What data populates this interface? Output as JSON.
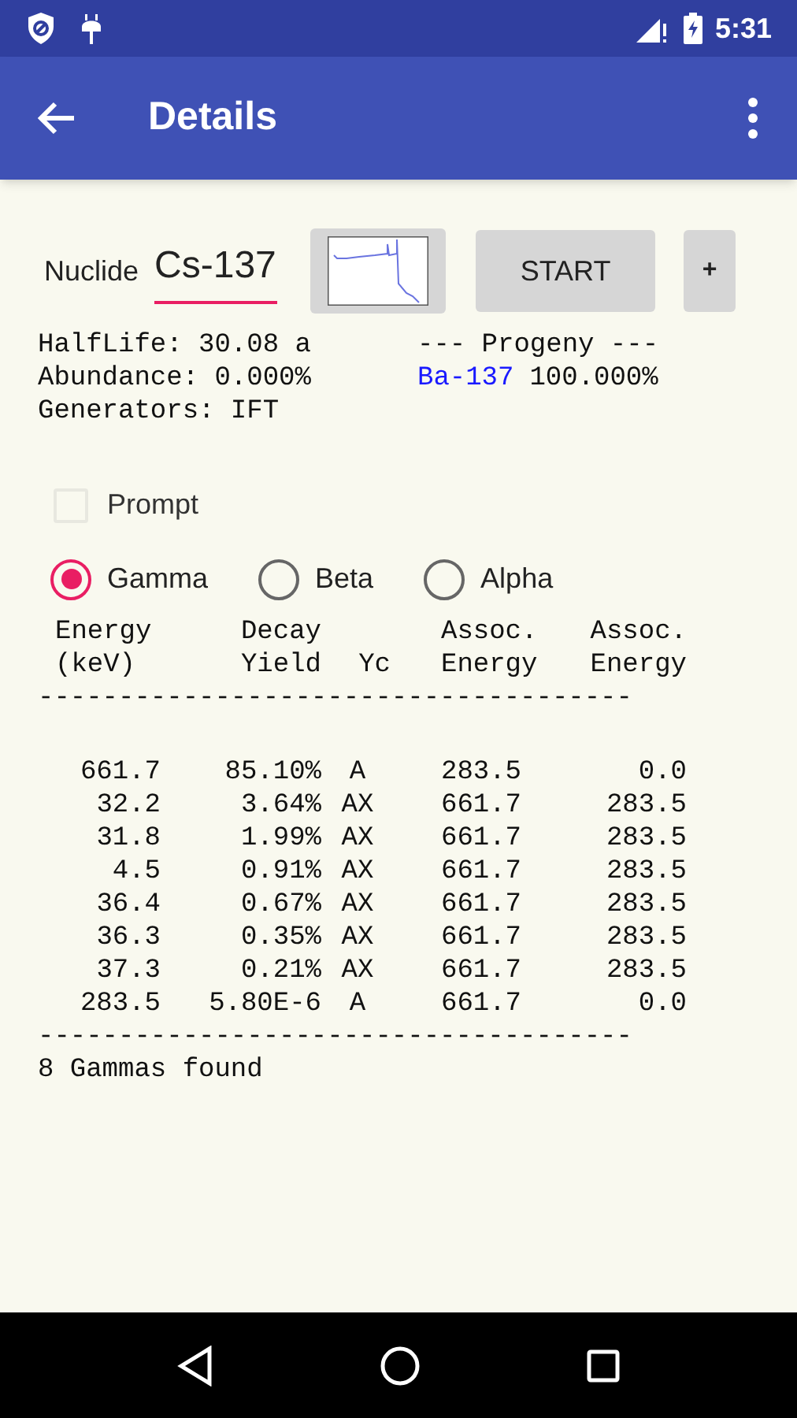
{
  "status_bar": {
    "time": "5:31"
  },
  "app_bar": {
    "title": "Details"
  },
  "nuclide": {
    "label": "Nuclide",
    "value": "Cs-137"
  },
  "buttons": {
    "start": "START",
    "add": "+"
  },
  "info": [
    "HalfLife: 30.08 a",
    "Abundance: 0.000%",
    "Generators: IFT"
  ],
  "progeny": {
    "heading": "--- Progeny ---",
    "nuclide": "Ba-137",
    "share": "100.000%"
  },
  "prompt": {
    "label": "Prompt",
    "checked": false
  },
  "radiation": [
    {
      "label": "Gamma",
      "selected": true
    },
    {
      "label": "Beta",
      "selected": false
    },
    {
      "label": "Alpha",
      "selected": false
    }
  ],
  "table": {
    "columns": [
      {
        "line_1": "Energy",
        "line_2": "(keV)"
      },
      {
        "line_1": "Decay",
        "line_2": "Yield"
      },
      {
        "line_2": "Yc"
      },
      {
        "line_1": "Assoc.",
        "line_2": "Energy"
      },
      {
        "line_1": "Assoc.",
        "line_2": "Energy"
      }
    ],
    "rule": "-------------------------------------",
    "rows": [
      [
        "661.7",
        "85.10%",
        "A",
        "283.5",
        "0.0"
      ],
      [
        "32.2",
        "3.64%",
        "AX",
        "661.7",
        "283.5"
      ],
      [
        "31.8",
        "1.99%",
        "AX",
        "661.7",
        "283.5"
      ],
      [
        "4.5",
        "0.91%",
        "AX",
        "661.7",
        "283.5"
      ],
      [
        "36.4",
        "0.67%",
        "AX",
        "661.7",
        "283.5"
      ],
      [
        "36.3",
        "0.35%",
        "AX",
        "661.7",
        "283.5"
      ],
      [
        "37.3",
        "0.21%",
        "AX",
        "661.7",
        "283.5"
      ],
      [
        "283.5",
        "5.80E-6",
        "A",
        "661.7",
        "0.0"
      ]
    ],
    "footer_rule": "-------------------------------------",
    "summary": "8 Gammas found"
  }
}
